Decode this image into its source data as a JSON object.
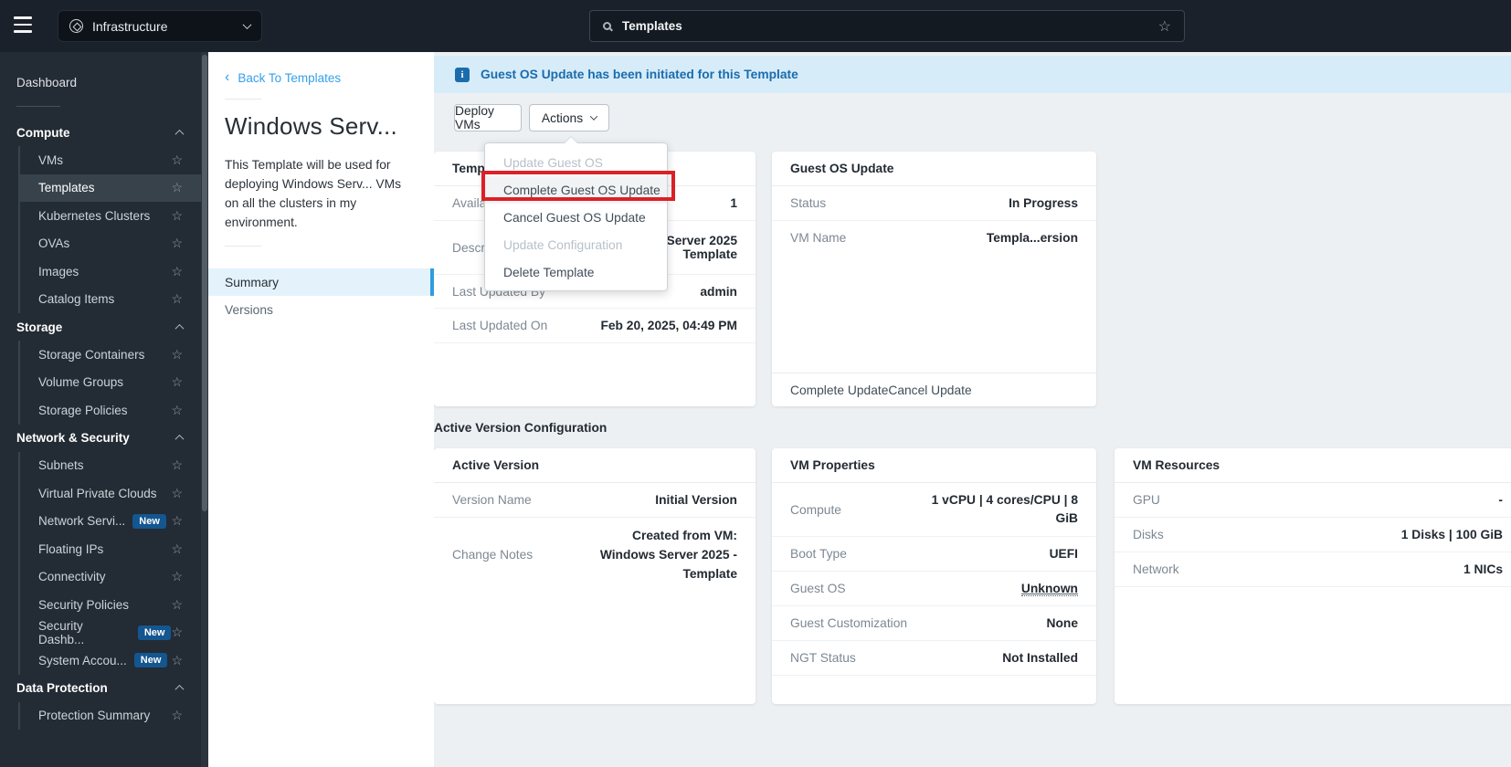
{
  "topbar": {
    "app_menu_label": "Infrastructure",
    "search_value": "Templates"
  },
  "sidebar": {
    "dashboard": "Dashboard",
    "sections": [
      {
        "label": "Compute",
        "items": [
          {
            "label": "VMs"
          },
          {
            "label": "Templates",
            "selected": true
          },
          {
            "label": "Kubernetes Clusters"
          },
          {
            "label": "OVAs"
          },
          {
            "label": "Images"
          },
          {
            "label": "Catalog Items"
          }
        ]
      },
      {
        "label": "Storage",
        "items": [
          {
            "label": "Storage Containers"
          },
          {
            "label": "Volume Groups"
          },
          {
            "label": "Storage Policies"
          }
        ]
      },
      {
        "label": "Network & Security",
        "items": [
          {
            "label": "Subnets"
          },
          {
            "label": "Virtual Private Clouds"
          },
          {
            "label": "Network Servi...",
            "badge": "New"
          },
          {
            "label": "Floating IPs"
          },
          {
            "label": "Connectivity"
          },
          {
            "label": "Security Policies"
          },
          {
            "label": "Security Dashb...",
            "badge": "New"
          },
          {
            "label": "System Accou...",
            "badge": "New"
          }
        ]
      },
      {
        "label": "Data Protection",
        "items": [
          {
            "label": "Protection Summary"
          }
        ]
      }
    ]
  },
  "panel": {
    "back_link": "Back To Templates",
    "title": "Windows Serv...",
    "description": "This Template will be used for deploying Windows Serv... VMs on all the clusters in my environment.",
    "tabs": [
      {
        "label": "Summary",
        "selected": true
      },
      {
        "label": "Versions"
      }
    ]
  },
  "main": {
    "banner_text": "Guest OS Update has been initiated for this Template",
    "toolbar": {
      "deploy_label": "Deploy VMs",
      "actions_label": "Actions"
    },
    "actions_menu": {
      "items": [
        {
          "label": "Update Guest OS",
          "disabled": true
        },
        {
          "label": "Complete Guest OS Update",
          "highlighted": true
        },
        {
          "label": "Cancel Guest OS Update"
        },
        {
          "label": "Update Configuration",
          "disabled": true
        },
        {
          "label": "Delete Template"
        }
      ]
    },
    "section_title": "Active Version Configuration",
    "cards": {
      "template": {
        "title": "Template",
        "rows": [
          [
            "Available Versions",
            "1"
          ],
          [
            "Description",
            "Windows Server 2025 Template"
          ],
          [
            "Last Updated By",
            "admin"
          ],
          [
            "Last Updated On",
            "Feb 20, 2025, 04:49 PM"
          ]
        ]
      },
      "guest_os_update": {
        "title": "Guest OS Update",
        "rows": [
          [
            "Status",
            "In Progress"
          ],
          [
            "VM Name",
            "Templa...ersion"
          ]
        ],
        "footer_links": [
          "Complete Update",
          "Cancel Update"
        ]
      },
      "active_version": {
        "title": "Active Version",
        "rows": [
          [
            "Version Name",
            "Initial Version"
          ],
          [
            "Change Notes",
            "Created from VM: Windows Server 2025 - Template"
          ]
        ]
      },
      "vm_properties": {
        "title": "VM Properties",
        "rows": [
          [
            "Compute",
            "1 vCPU | 4 cores/CPU | 8 GiB"
          ],
          [
            "Boot Type",
            "UEFI"
          ],
          [
            "Guest OS",
            "Unknown"
          ],
          [
            "Guest Customization",
            "None"
          ],
          [
            "NGT Status",
            "Not Installed"
          ]
        ]
      },
      "vm_resources": {
        "title": "VM Resources",
        "rows": [
          [
            "GPU",
            "-"
          ],
          [
            "Disks",
            "1 Disks | 100 GiB"
          ],
          [
            "Network",
            "1 NICs"
          ]
        ]
      }
    }
  },
  "colors": {
    "accent_blue": "#35a0ea",
    "banner_blue": "#1b6cad",
    "annotation_red": "#dc2026",
    "badge_blue": "#14568f",
    "sidebar_bg": "#232b34",
    "topbar_bg": "#1b212a"
  }
}
